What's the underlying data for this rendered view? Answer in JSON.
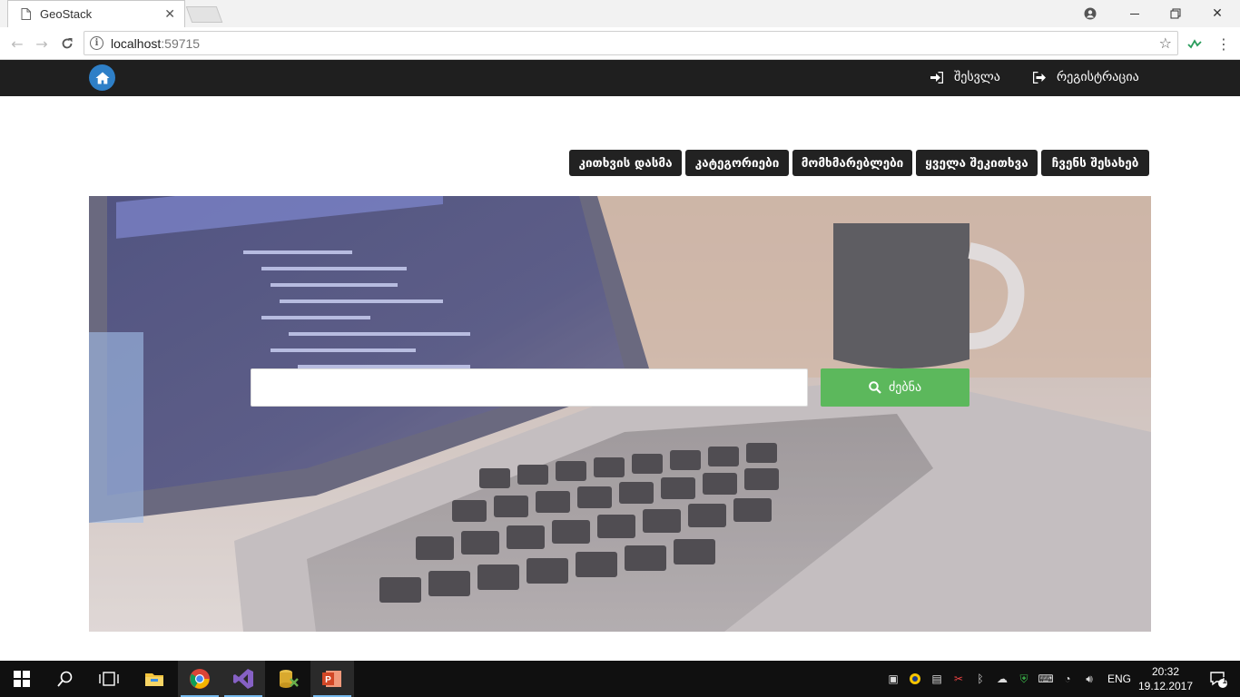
{
  "browser": {
    "tab_title": "GeoStack",
    "url_host": "localhost",
    "url_port": ":59715"
  },
  "site_nav": {
    "login_label": "შესვლა",
    "register_label": "რეგისტრაცია"
  },
  "categories": [
    "კითხვის დასმა",
    "კატეგორიები",
    "მომხმარებლები",
    "ყველა შეკითხვა",
    "ჩვენს შესახებ"
  ],
  "search": {
    "input_value": "",
    "button_label": "ძებნა"
  },
  "taskbar": {
    "lang": "ENG",
    "time": "20:32",
    "date": "19.12.2017",
    "notifications": "1"
  },
  "colors": {
    "accent_blue": "#2e7fc7",
    "search_green": "#5cb85c",
    "nav_dark": "#1f1f1f"
  }
}
